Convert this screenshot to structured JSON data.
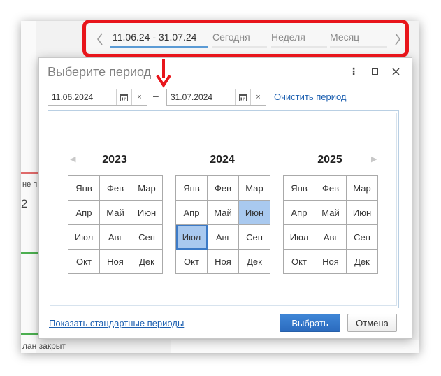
{
  "background": {
    "text_plan_partial": "не п",
    "number_partial": "2",
    "text_plan_closed": "лан закрыт"
  },
  "period_bar": {
    "prev_icon": "chevron-left-icon",
    "next_icon": "chevron-right-icon",
    "tabs": [
      {
        "label": "11.06.24 - 31.07.24",
        "active": true
      },
      {
        "label": "Сегодня",
        "active": false
      },
      {
        "label": "Неделя",
        "active": false
      },
      {
        "label": "Месяц",
        "active": false
      }
    ]
  },
  "dialog": {
    "title": "Выберите период",
    "start_date": "11.06.2024",
    "end_date": "31.07.2024",
    "separator": "–",
    "clear_link": "Очистить период",
    "years": [
      "2023",
      "2024",
      "2025"
    ],
    "months": [
      "Янв",
      "Фев",
      "Мар",
      "Апр",
      "Май",
      "Июн",
      "Июл",
      "Авг",
      "Сен",
      "Окт",
      "Ноя",
      "Дек"
    ],
    "selected": {
      "year": "2024",
      "months": [
        "Июн",
        "Июл"
      ]
    },
    "standard_periods_link": "Показать стандартные периоды",
    "ok_label": "Выбрать",
    "cancel_label": "Отмена"
  },
  "colors": {
    "accent": "#2b6bbf",
    "selection": "#a9c9ef",
    "highlight_frame": "#e8151b"
  }
}
